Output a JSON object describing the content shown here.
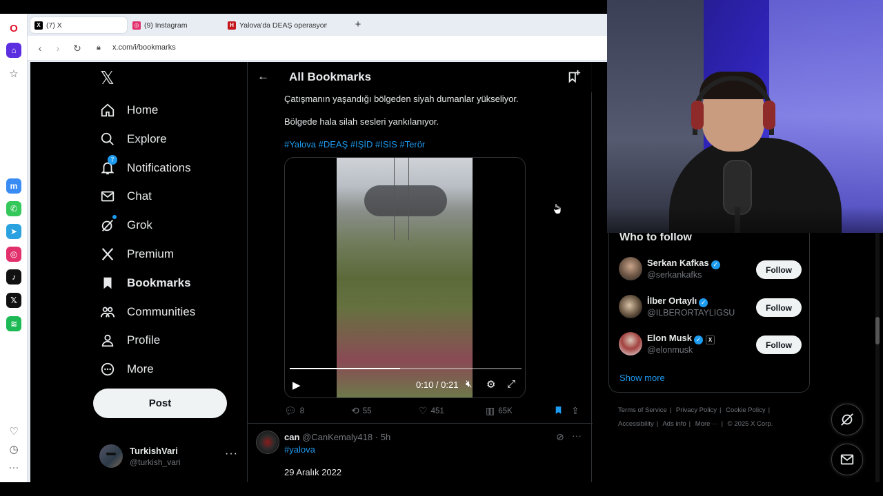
{
  "browser": {
    "tabs": [
      {
        "label": "(7) X",
        "favicon": "x-favicon",
        "active": true
      },
      {
        "label": "(9) Instagram",
        "favicon": "instagram-favicon",
        "active": false
      },
      {
        "label": "Yalova'da DEAŞ operasyon",
        "favicon": "haberturk-favicon",
        "active": false
      }
    ],
    "new_tab_glyph": "+",
    "url": "x.com/i/bookmarks"
  },
  "opera_sidebar": [
    "opera-logo-icon",
    "home-icon",
    "pinboard-icon",
    "messenger-icon",
    "whatsapp-icon",
    "telegram-icon",
    "instagram-icon",
    "tiktok-icon",
    "x-icon",
    "spotify-icon",
    "heart-icon",
    "history-icon",
    "more-icon"
  ],
  "nav": {
    "items": [
      {
        "label": "Home",
        "icon": "home-icon"
      },
      {
        "label": "Explore",
        "icon": "search-icon"
      },
      {
        "label": "Notifications",
        "icon": "bell-icon",
        "badge": "7"
      },
      {
        "label": "Chat",
        "icon": "mail-icon"
      },
      {
        "label": "Grok",
        "icon": "grok-icon"
      },
      {
        "label": "Premium",
        "icon": "x-icon"
      },
      {
        "label": "Bookmarks",
        "icon": "bookmark-icon",
        "active": true
      },
      {
        "label": "Communities",
        "icon": "people-icon"
      },
      {
        "label": "Profile",
        "icon": "person-icon"
      },
      {
        "label": "More",
        "icon": "more-circle-icon"
      }
    ],
    "post_label": "Post",
    "account": {
      "name": "TurkishVari",
      "handle": "@turkish_vari"
    }
  },
  "header": {
    "title": "All Bookmarks"
  },
  "tweet1": {
    "line1": "Çatışmanın yaşandığı bölgeden siyah dumanlar yükseliyor.",
    "line2": "Bölgede hala silah sesleri yankılanıyor.",
    "hashtags": "#Yalova #DEAŞ #IŞİD #ISIS #Terör",
    "video": {
      "time": "0:10 / 0:21",
      "progress": 0.476
    },
    "actions": {
      "replies": "8",
      "reposts": "55",
      "likes": "451",
      "views": "65K"
    }
  },
  "tweet2": {
    "name": "can",
    "handle": "@CanKemaly418",
    "separator": "·",
    "time": "5h",
    "hashtag": "#yalova",
    "text": "29 Aralık 2022"
  },
  "who_to_follow": {
    "title": "Who to follow",
    "follow_label": "Follow",
    "users": [
      {
        "name": "Serkan Kafkas",
        "handle": "@serkankafks",
        "verified": true
      },
      {
        "name": "İlber Ortaylı",
        "handle": "@ILBERORTAYLIGSU",
        "verified": true
      },
      {
        "name": "Elon Musk",
        "handle": "@elonmusk",
        "verified": true,
        "affiliate": "X"
      }
    ],
    "show_more": "Show more"
  },
  "footer": {
    "links": [
      "Terms of Service",
      "Privacy Policy",
      "Cookie Policy",
      "Accessibility",
      "Ads info",
      "More ···"
    ],
    "copyright": "© 2025 X Corp."
  },
  "colors": {
    "accent": "#1d9bf0",
    "background": "#000000",
    "text": "#e7e9ea",
    "muted": "#71767b"
  }
}
